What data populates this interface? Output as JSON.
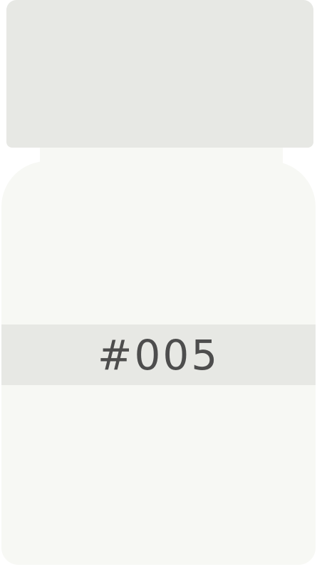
{
  "bottle": {
    "label": "#005",
    "colors": {
      "cap": "#e7e8e4",
      "body": "#f7f8f4",
      "band": "#e7e8e4",
      "text": "#4d4d4d"
    }
  }
}
